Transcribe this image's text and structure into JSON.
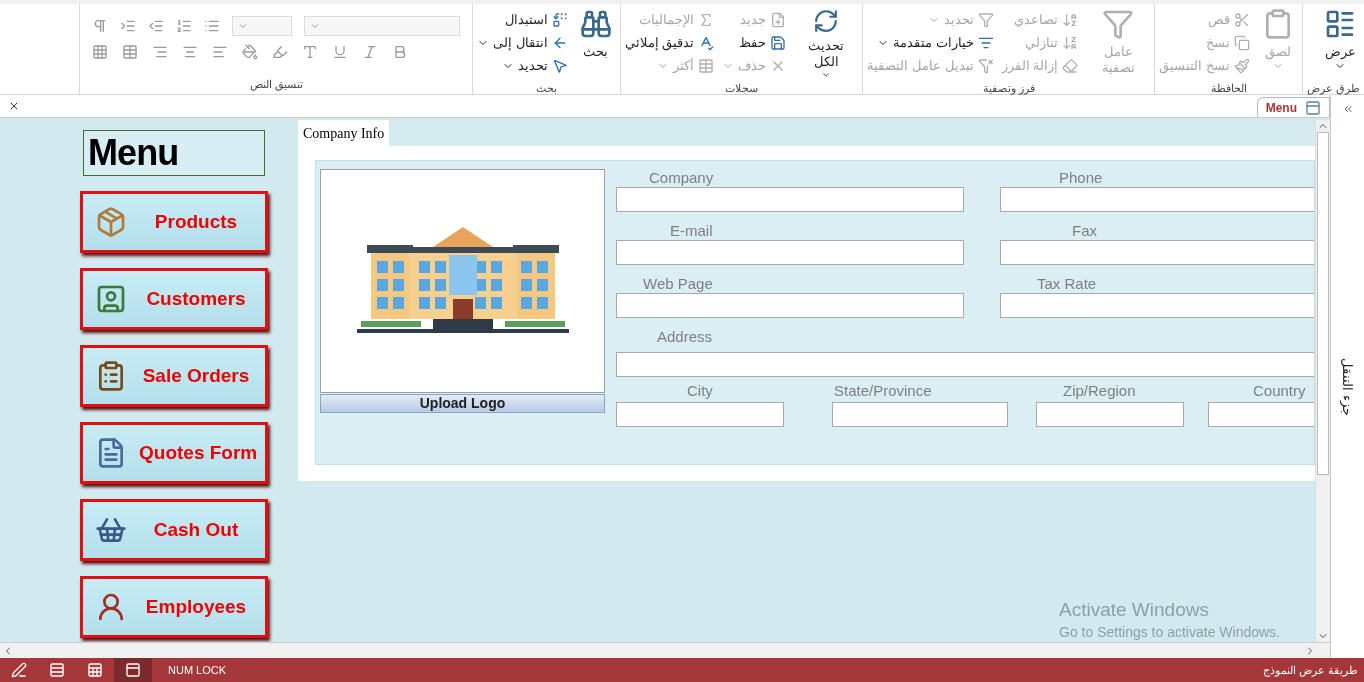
{
  "ribbon": {
    "groups": [
      {
        "label": "طرق عرض",
        "columns": [
          {
            "kind": "large",
            "commands": [
              {
                "label": "عرض",
                "disabled": false,
                "dropdown": true
              }
            ]
          }
        ]
      },
      {
        "label": "الحافظة",
        "columns": [
          {
            "kind": "large",
            "commands": [
              {
                "label": "لصق",
                "disabled": true,
                "dropdown": true
              }
            ]
          },
          {
            "kind": "small",
            "commands": [
              {
                "label": "قص",
                "disabled": true,
                "dropdown": false
              },
              {
                "label": "نسخ",
                "disabled": true,
                "dropdown": false
              },
              {
                "label": "نسخ التنسيق",
                "disabled": true,
                "dropdown": false
              }
            ]
          }
        ]
      },
      {
        "label": "فرز وتصفية",
        "columns": [
          {
            "kind": "large",
            "commands": [
              {
                "label": "عامل تصفية",
                "disabled": true,
                "dropdown": false
              }
            ]
          },
          {
            "kind": "small",
            "commands": [
              {
                "label": "تصاعدي",
                "disabled": true,
                "dropdown": false
              },
              {
                "label": "تنازلي",
                "disabled": true,
                "dropdown": false
              },
              {
                "label": "إزالة الفرز",
                "disabled": true,
                "dropdown": false
              }
            ]
          },
          {
            "kind": "small",
            "commands": [
              {
                "label": "تحديد",
                "disabled": true,
                "dropdown": true
              },
              {
                "label": "خيارات متقدمة",
                "disabled": false,
                "dropdown": true
              },
              {
                "label": "تبديل عامل التصفية",
                "disabled": true,
                "dropdown": false
              }
            ]
          }
        ]
      },
      {
        "label": "سجلات",
        "columns": [
          {
            "kind": "large",
            "commands": [
              {
                "label": "تحديث الكل",
                "disabled": false,
                "dropdown": true
              }
            ]
          },
          {
            "kind": "small",
            "commands": [
              {
                "label": "جديد",
                "disabled": true,
                "dropdown": false
              },
              {
                "label": "حفظ",
                "disabled": false,
                "dropdown": false
              },
              {
                "label": "حذف",
                "disabled": true,
                "dropdown": true
              }
            ]
          },
          {
            "kind": "small",
            "commands": [
              {
                "label": "الإجماليات",
                "disabled": true,
                "dropdown": false
              },
              {
                "label": "تدقيق إملائي",
                "disabled": false,
                "dropdown": false
              },
              {
                "label": "أكثر",
                "disabled": true,
                "dropdown": true
              }
            ]
          }
        ]
      },
      {
        "label": "بحث",
        "columns": [
          {
            "kind": "large",
            "commands": [
              {
                "label": "بحث",
                "disabled": false,
                "dropdown": false
              }
            ]
          },
          {
            "kind": "small",
            "commands": [
              {
                "label": "استبدال",
                "disabled": false,
                "dropdown": false
              },
              {
                "label": "انتقال إلى",
                "disabled": false,
                "dropdown": true
              },
              {
                "label": "تحديد",
                "disabled": false,
                "dropdown": true
              }
            ]
          }
        ]
      },
      {
        "label": "تنسيق النص",
        "columns": [
          {
            "kind": "format"
          }
        ]
      }
    ]
  },
  "document_tabs": [
    {
      "label": "Menu",
      "selected": true
    }
  ],
  "menu": {
    "title": "Menu",
    "buttons": [
      {
        "label": "Products",
        "kind": "box"
      },
      {
        "label": "Customers",
        "kind": "user"
      },
      {
        "label": "Sale Orders",
        "kind": "clipboard"
      },
      {
        "label": "Quotes Form",
        "kind": "document"
      },
      {
        "label": "Cash Out",
        "kind": "basket"
      },
      {
        "label": "Employees",
        "kind": "employee"
      }
    ]
  },
  "form": {
    "tabs": [
      {
        "label": "Company Info",
        "selected": true
      }
    ],
    "upload_button": "Upload Logo",
    "fields": {
      "company": {
        "label": "Company"
      },
      "phone": {
        "label": "Phone"
      },
      "email": {
        "label": "E-mail"
      },
      "fax": {
        "label": "Fax"
      },
      "web_page": {
        "label": "Web Page"
      },
      "tax_rate": {
        "label": "Tax Rate"
      },
      "address": {
        "label": "Address"
      },
      "city": {
        "label": "City"
      },
      "state": {
        "label": "State/Province"
      },
      "zip": {
        "label": "Zip/Region"
      },
      "country": {
        "label": "Country"
      }
    }
  },
  "navigation_pane": {
    "label": "جزء التنقل"
  },
  "windows_notice": {
    "title": "Activate Windows",
    "subtitle": "Go to Settings to activate Windows."
  },
  "status_bar": {
    "text": "طريقة عرض النموذج",
    "indicator": "NUM LOCK",
    "views": [
      {
        "selected": false
      },
      {
        "selected": false
      },
      {
        "selected": false
      },
      {
        "selected": true
      }
    ]
  }
}
